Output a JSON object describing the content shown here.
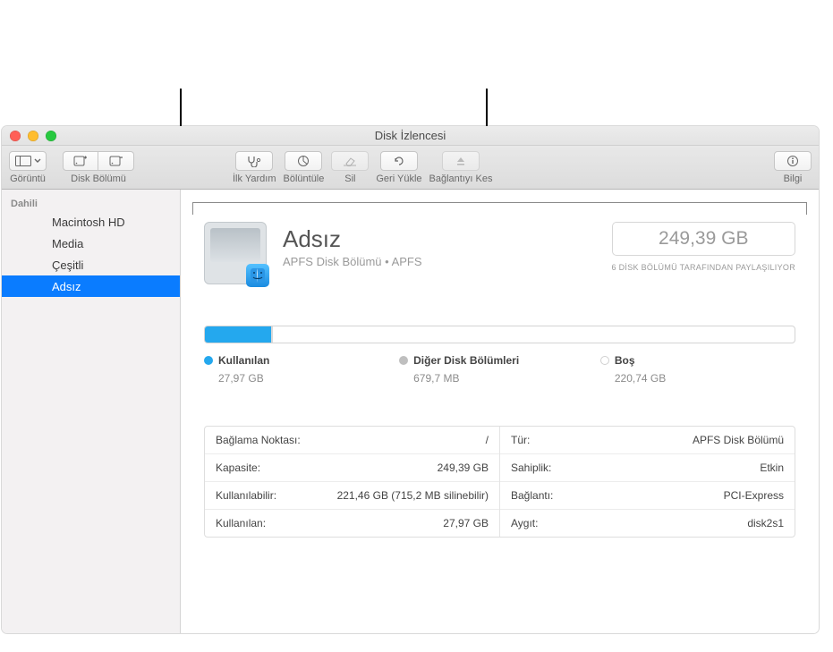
{
  "window": {
    "title": "Disk İzlencesi"
  },
  "toolbar": {
    "view_label": "Görüntü",
    "partition_label": "Disk Bölümü",
    "first_aid_label": "İlk Yardım",
    "partition_btn_label": "Bölüntüle",
    "erase_label": "Sil",
    "restore_label": "Geri Yükle",
    "unmount_label": "Bağlantıyı Kes",
    "info_label": "Bilgi"
  },
  "sidebar": {
    "header": "Dahili",
    "items": [
      {
        "label": "Macintosh HD"
      },
      {
        "label": "Media"
      },
      {
        "label": "Çeşitli"
      },
      {
        "label": "Adsız"
      }
    ],
    "selected_index": 3
  },
  "volume": {
    "name": "Adsız",
    "subtitle": "APFS Disk Bölümü • APFS",
    "capacity": "249,39 GB",
    "shared_by": "6 DİSK BÖLÜMÜ TARAFINDAN PAYLAŞILIYOR"
  },
  "usage": {
    "used": {
      "label": "Kullanılan",
      "value": "27,97 GB",
      "color": "#24a8ee",
      "pct": 11.2
    },
    "other": {
      "label": "Diğer Disk Bölümleri",
      "value": "679,7 MB",
      "color": "#d0d0d0",
      "pct": 0.3
    },
    "free": {
      "label": "Boş",
      "value": "220,74 GB",
      "color": "#ffffff",
      "pct": 88.5
    }
  },
  "info": {
    "left": [
      {
        "k": "Bağlama Noktası:",
        "v": "/"
      },
      {
        "k": "Kapasite:",
        "v": "249,39 GB"
      },
      {
        "k": "Kullanılabilir:",
        "v": "221,46 GB (715,2 MB silinebilir)"
      },
      {
        "k": "Kullanılan:",
        "v": "27,97 GB"
      }
    ],
    "right": [
      {
        "k": "Tür:",
        "v": "APFS Disk Bölümü"
      },
      {
        "k": "Sahiplik:",
        "v": "Etkin"
      },
      {
        "k": "Bağlantı:",
        "v": "PCI-Express"
      },
      {
        "k": "Aygıt:",
        "v": "disk2s1"
      }
    ]
  }
}
